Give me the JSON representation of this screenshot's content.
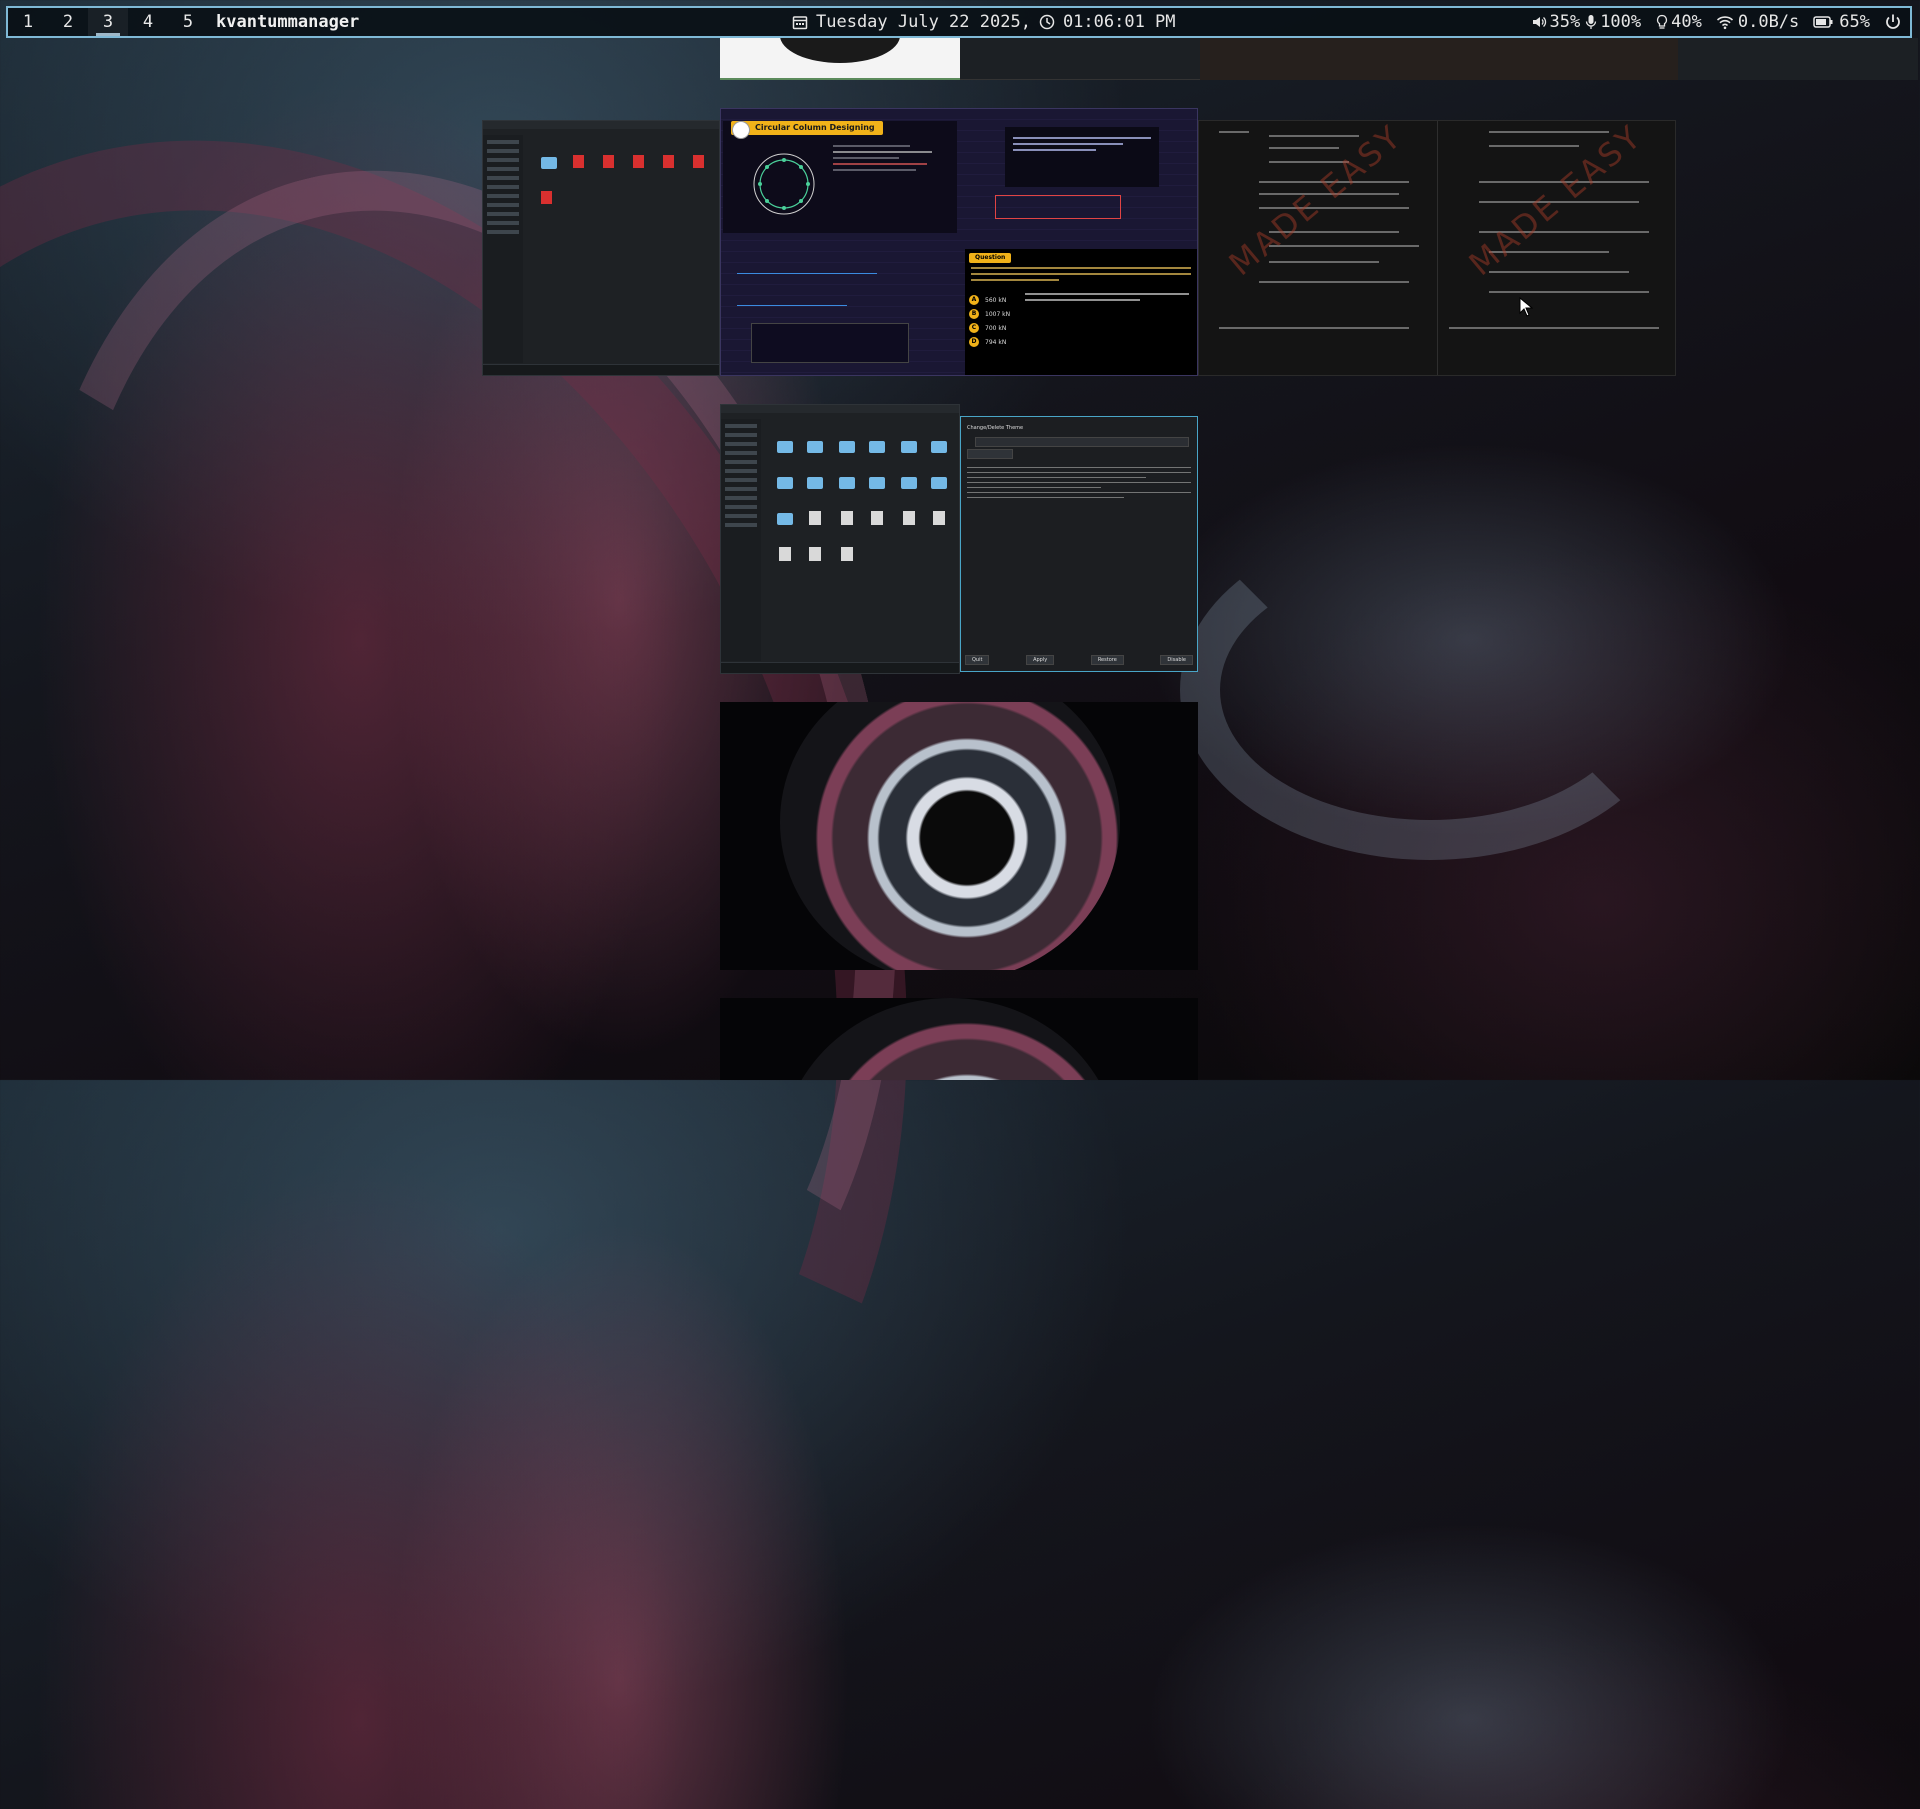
{
  "topbar": {
    "workspaces": [
      "1",
      "2",
      "3",
      "4",
      "5"
    ],
    "active_workspace": "3",
    "window_title": "kvantummanager",
    "date": "Tuesday July 22 2025,",
    "time": "01:06:01 PM",
    "volume": "35%",
    "mic": "100%",
    "brightness": "40%",
    "network": "0.0B/s",
    "battery": "65%"
  },
  "windows": {
    "lecture": {
      "banner": "Circular Column Designing",
      "question_tag": "Question",
      "options": [
        {
          "letter": "A",
          "text": "560 kN"
        },
        {
          "letter": "B",
          "text": "1007 kN"
        },
        {
          "letter": "C",
          "text": "700 kN"
        },
        {
          "letter": "D",
          "text": "794 kN"
        }
      ]
    },
    "notes": {
      "watermark": "MADE EASY"
    },
    "kvantum": {
      "tab": "Change/Delete Theme",
      "buttons": [
        "Quit",
        "Apply",
        "Restore",
        "Disable"
      ]
    }
  },
  "colors": {
    "bar_border": "#7fb9d6",
    "folder": "#74b9e6",
    "pdf": "#d9302f",
    "banner": "#f1b219"
  }
}
